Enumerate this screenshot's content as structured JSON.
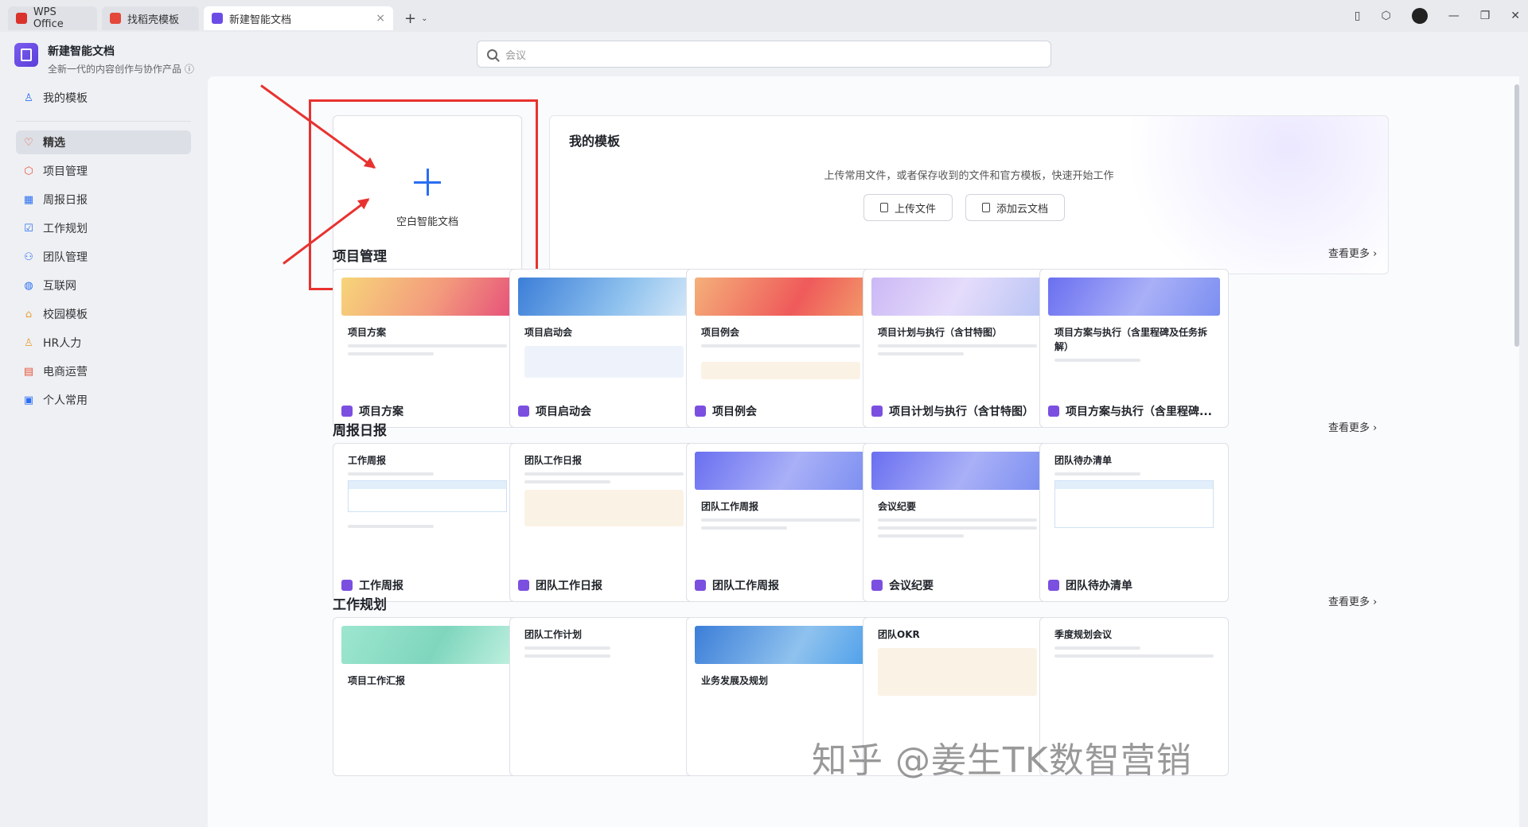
{
  "tabs": [
    {
      "label": "WPS Office",
      "color": "#d9332b"
    },
    {
      "label": "找稻壳模板",
      "color": "#e5463a"
    },
    {
      "label": "新建智能文档",
      "color": "#6b4de6"
    }
  ],
  "tab_close": "×",
  "new_tab": "+",
  "new_tab_caret": "⌄",
  "window_controls": {
    "minimize": "—",
    "restore": "❐",
    "close": "✕",
    "layout": "▯",
    "box": "⬡"
  },
  "doc": {
    "title": "新建智能文档",
    "subtitle": "全新一代的内容创作与协作产品 ⓘ"
  },
  "sidebar": {
    "my_templates": "我的模板",
    "items": [
      {
        "label": "精选",
        "icon": "♡"
      },
      {
        "label": "项目管理",
        "icon": "⬡"
      },
      {
        "label": "周报日报",
        "icon": "▦"
      },
      {
        "label": "工作规划",
        "icon": "☑"
      },
      {
        "label": "团队管理",
        "icon": "⚇"
      },
      {
        "label": "互联网",
        "icon": "◍"
      },
      {
        "label": "校园模板",
        "icon": "⌂"
      },
      {
        "label": "HR人力",
        "icon": "♙"
      },
      {
        "label": "电商运营",
        "icon": "▤"
      },
      {
        "label": "个人常用",
        "icon": "▣"
      }
    ]
  },
  "search": {
    "placeholder": "会议"
  },
  "blank": {
    "label": "空白智能文档"
  },
  "my_template_panel": {
    "title": "我的模板",
    "desc": "上传常用文件，或者保存收到的文件和官方模板，快速开始工作",
    "upload": "上传文件",
    "add_cloud": "添加云文档"
  },
  "more_label": "查看更多 ›",
  "sections": [
    {
      "title": "项目管理",
      "cards": [
        {
          "thumb_title": "项目方案",
          "label": "项目方案",
          "banner": "linear-gradient(120deg,#f7d57a,#f39a7c 55%,#e6507a)"
        },
        {
          "thumb_title": "项目启动会",
          "label": "项目启动会",
          "banner": "linear-gradient(120deg,#3c7ed8,#8fc2ee 60%,#d6e8f8)"
        },
        {
          "thumb_title": "项目例会",
          "label": "项目例会",
          "banner": "linear-gradient(120deg,#f4b07a,#ef5a5a 60%,#f29a6a)"
        },
        {
          "thumb_title": "项目计划与执行（含甘特图）",
          "label": "项目计划与执行（含甘特图）",
          "banner": "linear-gradient(120deg,#cbb8f5,#e5dcfb 50%,#b8c4f4)"
        },
        {
          "thumb_title": "项目方案与执行（含里程碑及任务拆解）",
          "label": "项目方案与执行（含里程碑...",
          "banner": "linear-gradient(120deg,#6a6ff0,#a9b0f7 55%,#7b8ef0)"
        }
      ]
    },
    {
      "title": "周报日报",
      "cards": [
        {
          "thumb_title": "工作周报",
          "label": "工作周报",
          "banner": ""
        },
        {
          "thumb_title": "团队工作日报",
          "label": "团队工作日报",
          "banner": ""
        },
        {
          "thumb_title": "团队工作周报",
          "label": "团队工作周报",
          "banner": "linear-gradient(120deg,#6a6ff0,#a9b0f7 55%,#7b8ef0)"
        },
        {
          "thumb_title": "会议纪要",
          "label": "会议纪要",
          "banner": "linear-gradient(120deg,#6a6ff0,#a9b0f7 55%,#7b8ef0)"
        },
        {
          "thumb_title": "团队待办清单",
          "label": "团队待办清单",
          "banner": ""
        }
      ]
    },
    {
      "title": "工作规划",
      "cards": [
        {
          "thumb_title": "项目工作汇报",
          "label": "项目工作汇报",
          "banner": "linear-gradient(120deg,#9de6cf,#7fd6bd 55%,#bff0df)"
        },
        {
          "thumb_title": "团队工作计划",
          "label": "团队工作计划",
          "banner": ""
        },
        {
          "thumb_title": "业务发展及规划",
          "label": "业务发展及规划",
          "banner": "linear-gradient(120deg,#3c7ed8,#8fc2ee 60%,#4fa0ea)"
        },
        {
          "thumb_title": "团队OKR",
          "label": "团队OKR",
          "banner": ""
        },
        {
          "thumb_title": "季度规划会议",
          "label": "季度规划会议",
          "banner": ""
        }
      ]
    }
  ],
  "watermark": "知乎 @姜生TK数智营销",
  "colors": {
    "accent": "#2b6ef2",
    "highlight": "#e8322f",
    "doc_icon": "#7b4fe0"
  }
}
